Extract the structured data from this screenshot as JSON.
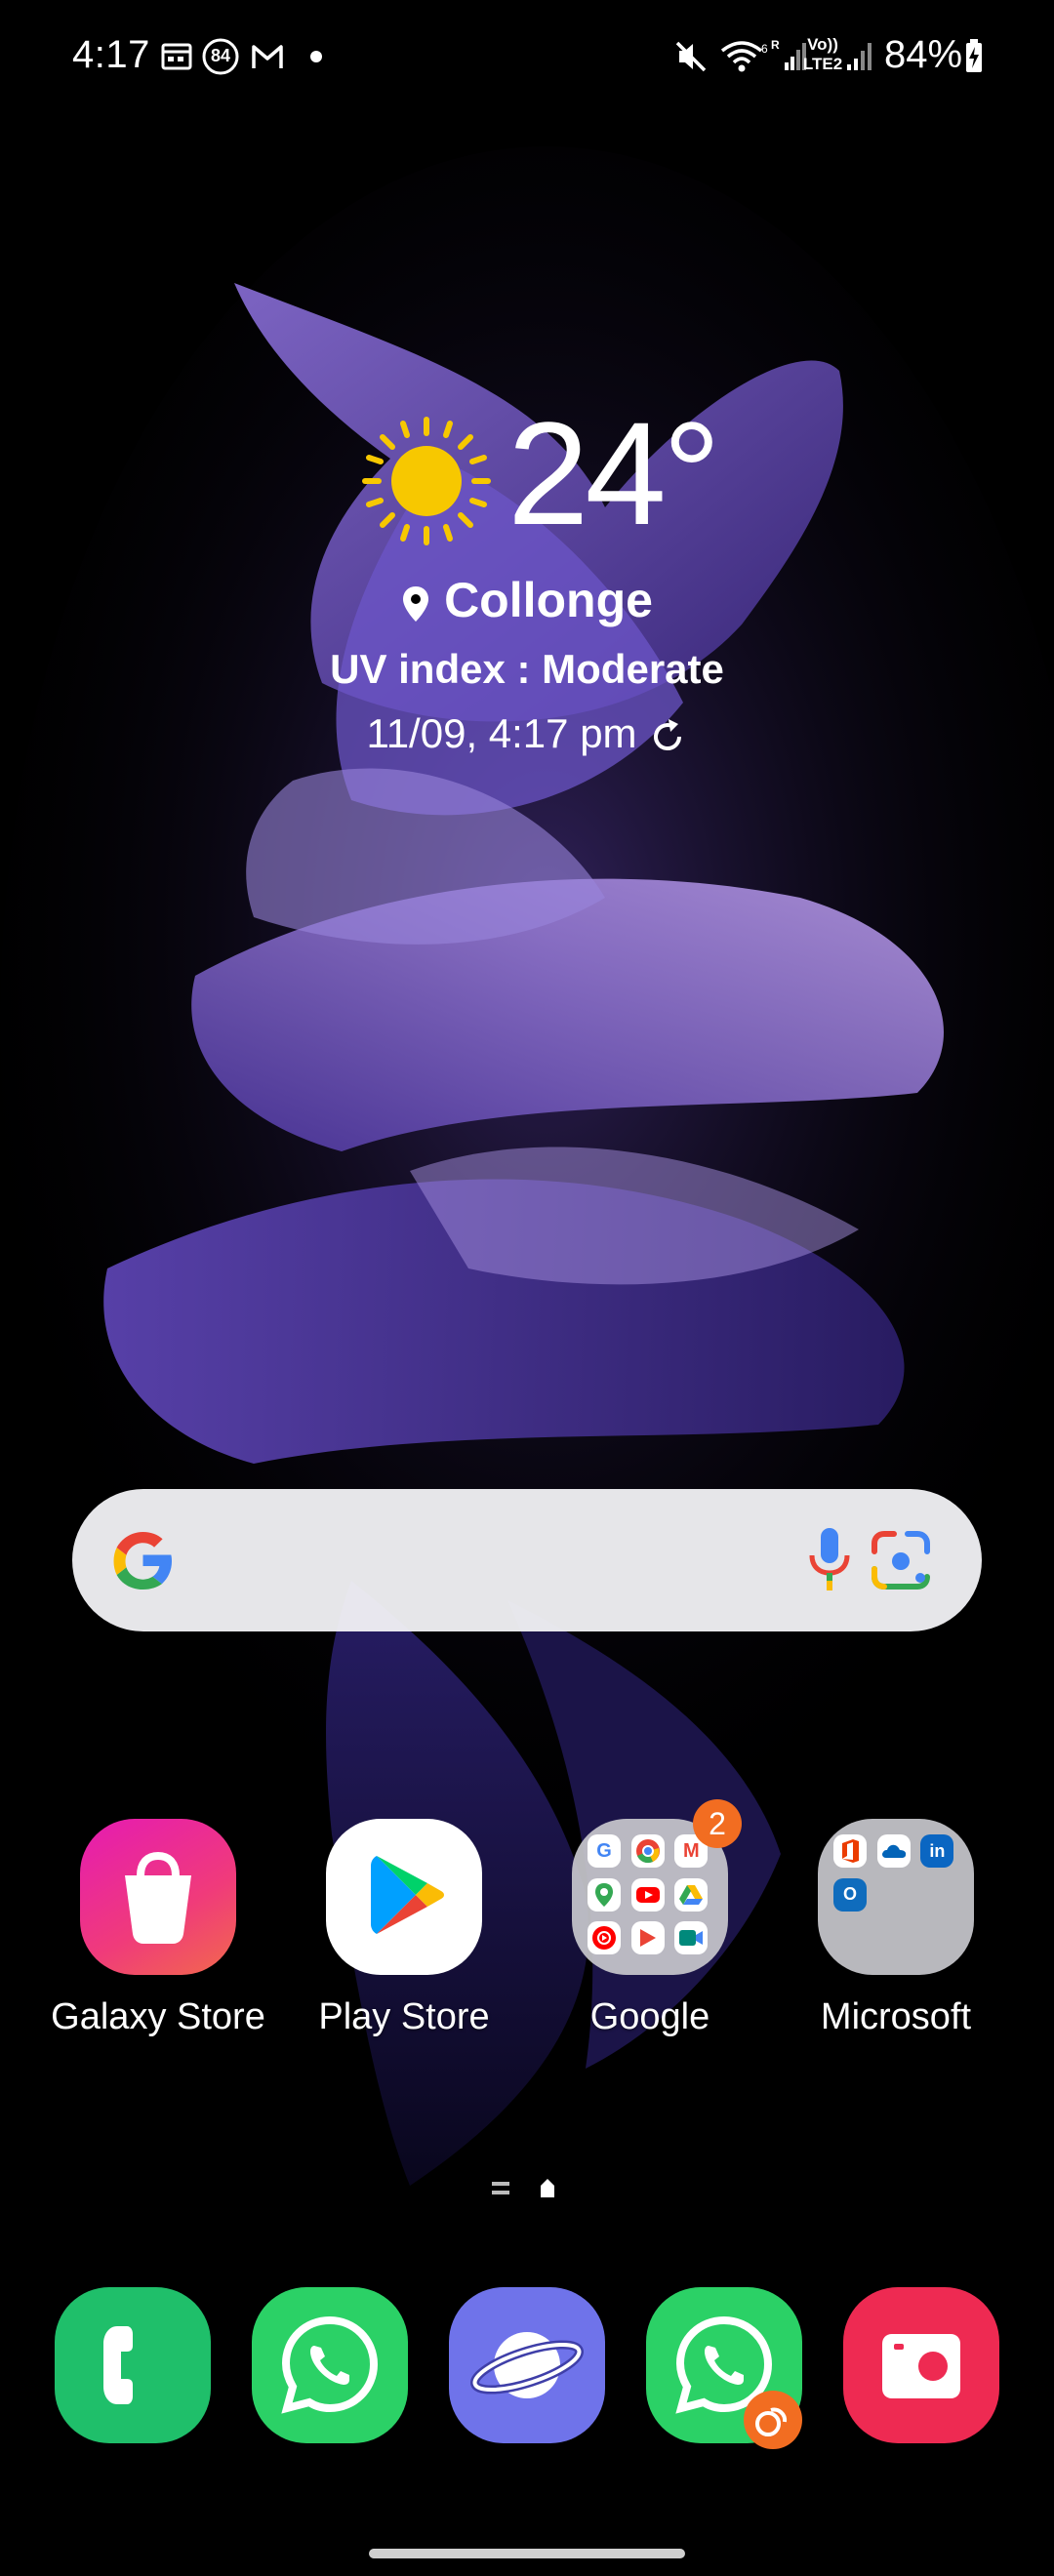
{
  "status_bar": {
    "time": "4:17",
    "notification_icons": [
      "calendar-icon",
      "aqi-84-icon",
      "gmail-icon",
      "more-dot-icon"
    ],
    "aqi_value": "84",
    "system_icons": [
      "mute-icon",
      "wifi-icon",
      "signal-icon",
      "volte-lte2-icon",
      "signal-icon"
    ],
    "volte_label": "Vo)) LTE2",
    "battery_percent": "84%"
  },
  "weather": {
    "temperature": "24°",
    "location": "Collonge",
    "uv": "UV index : Moderate",
    "updated": "11/09, 4:17 pm",
    "icon": "sun-icon"
  },
  "search_bar": {
    "icons": [
      "google-g-icon",
      "microphone-icon",
      "google-lens-icon"
    ]
  },
  "apps": [
    {
      "label": "Galaxy Store",
      "icon": "galaxy-store-icon"
    },
    {
      "label": "Play Store",
      "icon": "play-store-icon"
    },
    {
      "label": "Google",
      "icon": "google-folder-icon",
      "badge": "2"
    },
    {
      "label": "Microsoft",
      "icon": "microsoft-folder-icon"
    }
  ],
  "page_indicator": [
    "menu-lines-icon",
    "home-page-icon"
  ],
  "dock": [
    {
      "icon": "phone-icon",
      "color": "#1fbf6a"
    },
    {
      "icon": "whatsapp-icon",
      "color": "#2bd166"
    },
    {
      "icon": "samsung-internet-icon",
      "color": "#6f73ea"
    },
    {
      "icon": "whatsapp-dual-icon",
      "color": "#2bd166"
    },
    {
      "icon": "camera-icon",
      "color": "#ee2a52"
    }
  ],
  "colors": {
    "background": "#000000",
    "badge": "#f26d21",
    "search_bar": "#f2f2f6",
    "wallpaper_purple": "#6a4fc0"
  }
}
